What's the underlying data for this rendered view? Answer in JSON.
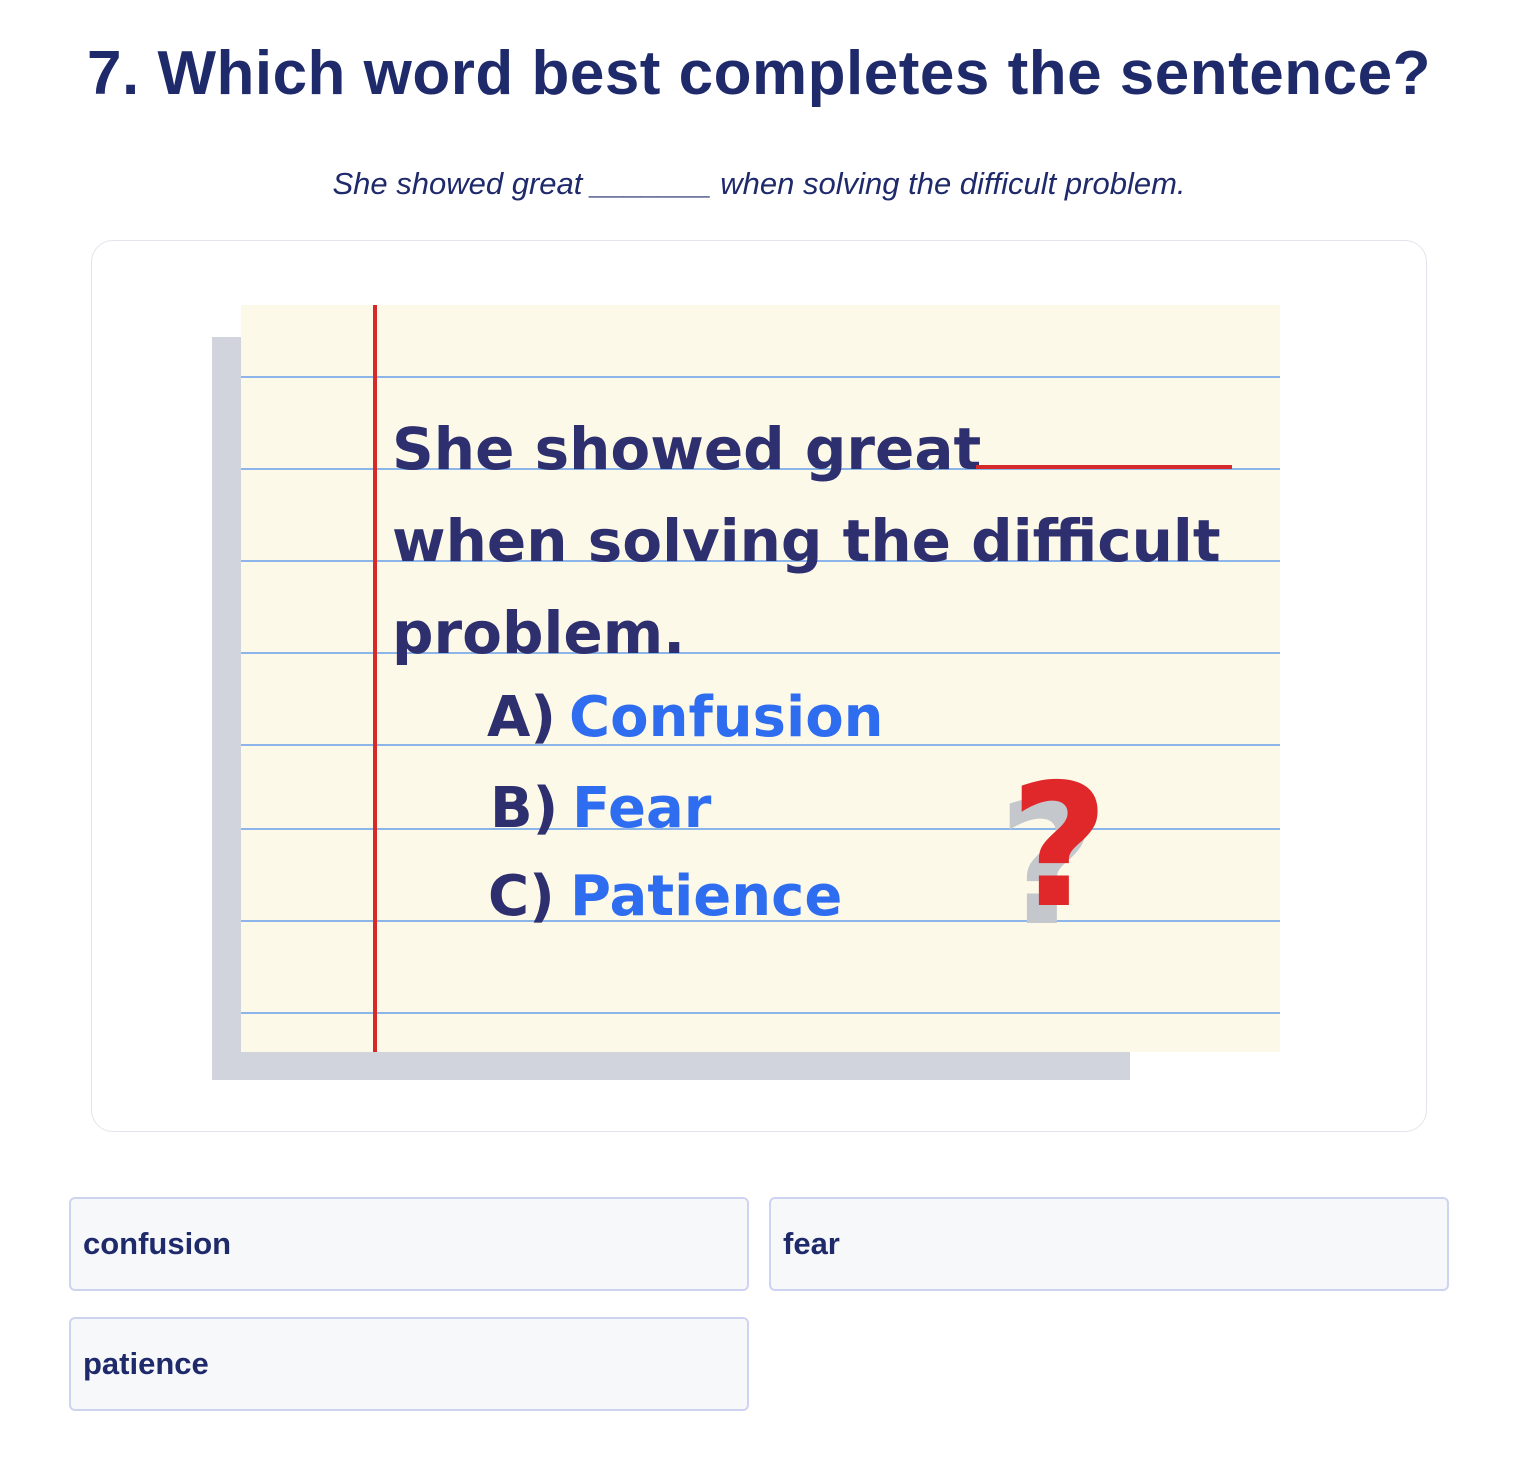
{
  "question": {
    "title": "7. Which word best completes the sentence?",
    "sentence": "She showed great _______ when solving the difficult problem."
  },
  "illustration": {
    "line1": "She showed great",
    "line2": "when solving the difficult",
    "line3": "problem.",
    "choices": [
      {
        "letter": "A)",
        "word": "Confusion"
      },
      {
        "letter": "B)",
        "word": "Fear"
      },
      {
        "letter": "C)",
        "word": "Patience"
      }
    ],
    "question_mark": "?",
    "colors": {
      "paper": "#fdf9e9",
      "shadow": "#d1d4dc",
      "rule_line": "#8cb6ea",
      "margin_line": "#d62a2a",
      "text": "#2d2f6e",
      "option_text": "#2f6df0",
      "question_mark": "#e0272a"
    }
  },
  "answers": [
    {
      "label": "confusion"
    },
    {
      "label": "fear"
    },
    {
      "label": "patience"
    }
  ],
  "colors": {
    "title": "#1f2a6b",
    "option_bg": "#f7f8fa",
    "option_border": "#cfd3f2"
  }
}
